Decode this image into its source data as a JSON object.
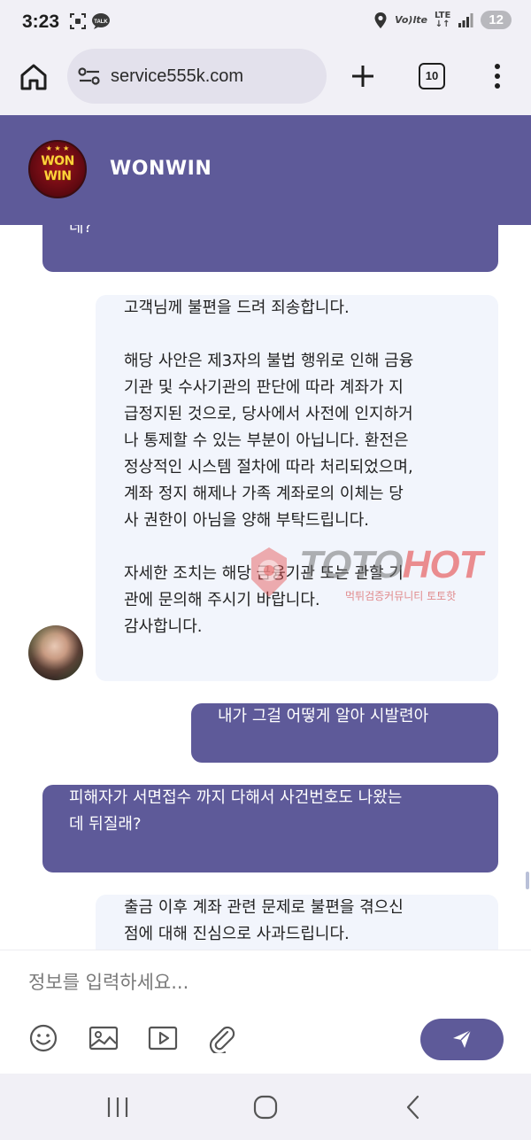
{
  "status_bar": {
    "time": "3:23",
    "volte_label": "Vo)lte",
    "lte_label": "LTE",
    "battery": "12",
    "icons": [
      "screenshot-icon",
      "talk-icon",
      "location-icon",
      "signal-icon"
    ],
    "talk_label": "TALK"
  },
  "browser": {
    "url": "service555k.com",
    "tab_count": "10"
  },
  "chat_header": {
    "brand_name": "WONWIN",
    "logo_line1": "WON",
    "logo_line2": "WIN"
  },
  "messages": [
    {
      "role": "user",
      "lines": [
        "데?"
      ]
    },
    {
      "role": "agent",
      "lines": [
        "고객님께 불편을 드려 죄송합니다.",
        "",
        "해당 사안은 제3자의 불법 행위로 인해 금융",
        "기관 및 수사기관의 판단에 따라 계좌가 지",
        "급정지된 것으로, 당사에서 사전에 인지하거",
        "나 통제할 수 있는 부분이 아닙니다. 환전은",
        "정상적인 시스템 절차에 따라 처리되었으며,",
        "계좌 정지 해제나 가족 계좌로의 이체는 당",
        "사 권한이 아님을 양해 부탁드립니다.",
        "",
        "자세한 조치는 해당 금융기관 또는 관할 기",
        "관에 문의해 주시기 바랍니다.",
        "감사합니다."
      ]
    },
    {
      "role": "user",
      "lines": [
        "내가 그걸 어떻게 알아 시발련아"
      ]
    },
    {
      "role": "user",
      "lines": [
        "피해자가 서면접수 까지 다해서 사건번호도 나왔는",
        "데 뒤질래?"
      ]
    },
    {
      "role": "agent",
      "lines": [
        "출금 이후 계좌 관련 문제로 불편을 겪으신",
        "점에 대해 진심으로 사과드립니다."
      ]
    }
  ],
  "watermark": {
    "toto": "TOTO",
    "hot": "HOT",
    "sub": "먹튀검증커뮤니티 토토핫"
  },
  "composer": {
    "placeholder": "정보를 입력하세요...",
    "tools": [
      "emoji-icon",
      "image-icon",
      "video-icon",
      "attachment-icon"
    ]
  },
  "colors": {
    "accent": "#5e5a99",
    "agent_bubble": "#f2f5fc",
    "chrome_bg": "#f1f0f6",
    "url_bg": "#e3e1ec"
  }
}
